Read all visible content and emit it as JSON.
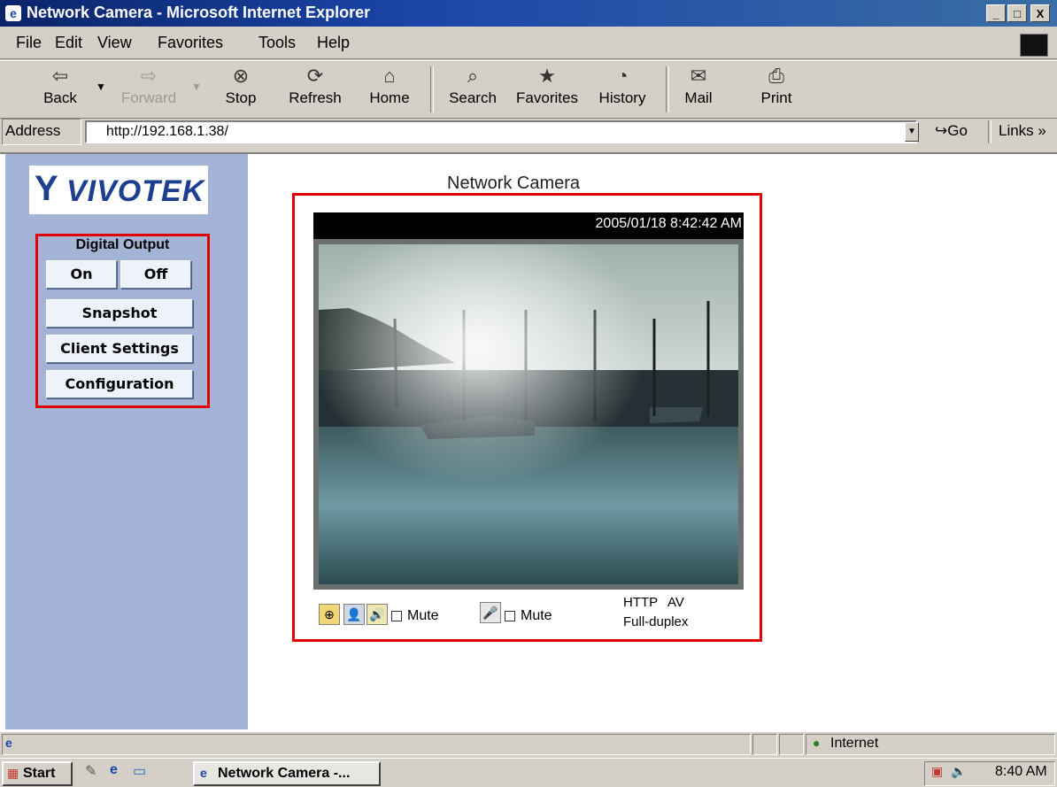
{
  "window": {
    "title": "Network Camera - Microsoft Internet Explorer",
    "min": "_",
    "max": "□",
    "close": "X"
  },
  "menu": [
    "File",
    "Edit",
    "View",
    "Favorites",
    "Tools",
    "Help"
  ],
  "toolbar": {
    "back": "Back",
    "forward": "Forward",
    "stop": "Stop",
    "refresh": "Refresh",
    "home": "Home",
    "search": "Search",
    "favorites": "Favorites",
    "history": "History",
    "mail": "Mail",
    "print": "Print"
  },
  "address": {
    "label": "Address",
    "url": "http://192.168.1.38/",
    "go": "Go",
    "links": "Links »"
  },
  "sidebar": {
    "logo": "VIVOTEK",
    "digital_output": "Digital Output",
    "on": "On",
    "off": "Off",
    "snapshot": "Snapshot",
    "client_settings": "Client Settings",
    "configuration": "Configuration"
  },
  "camera": {
    "title": "Network Camera",
    "timestamp": "2005/01/18 8:42:42 AM",
    "mute1": "Mute",
    "mute2": "Mute",
    "protocol": "HTTP",
    "mode": "AV",
    "duplex": "Full-duplex"
  },
  "status": {
    "zone": "Internet"
  },
  "taskbar": {
    "start": "Start",
    "task": "Network Camera -...",
    "clock": "8:40 AM"
  }
}
